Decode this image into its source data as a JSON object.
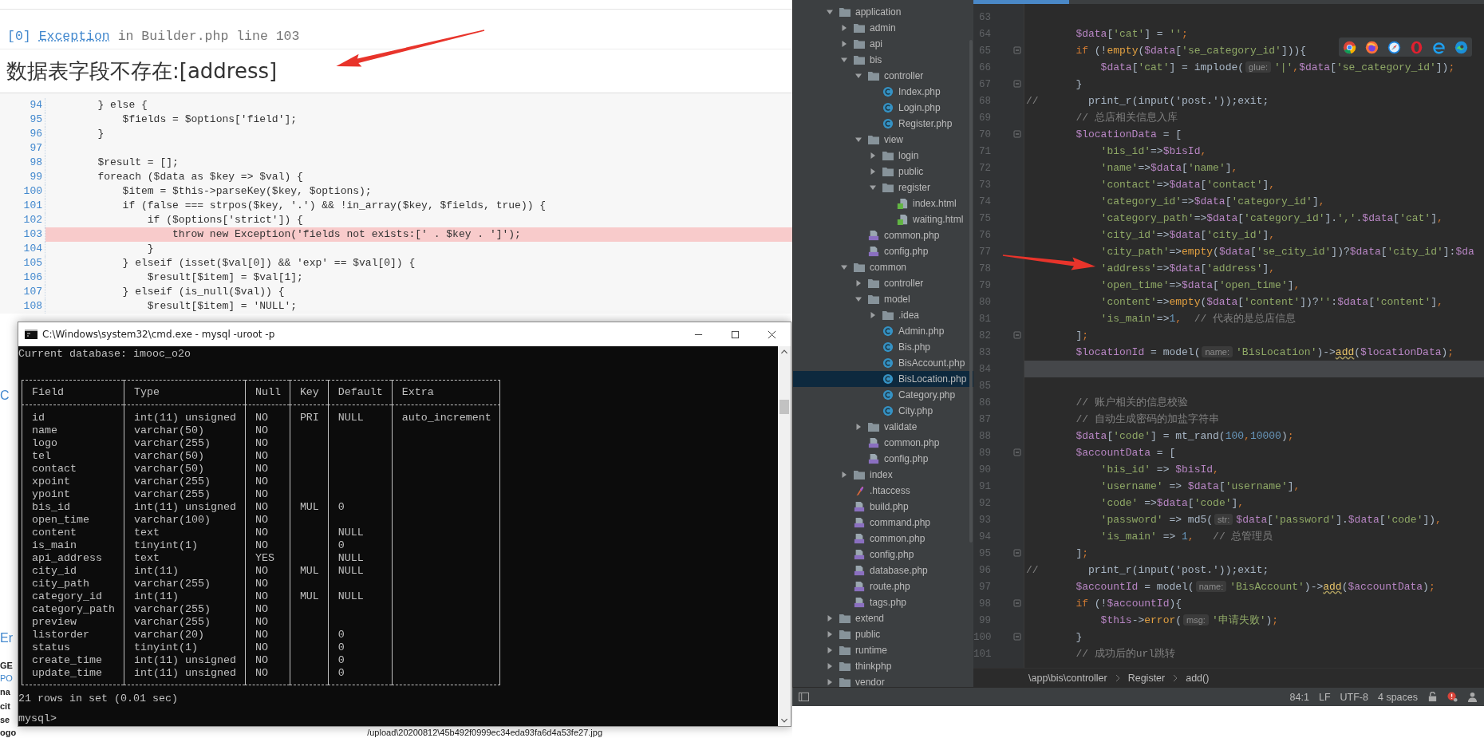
{
  "browser_page": {
    "exception": {
      "index": "[0]",
      "class": "Exception",
      "location": "in Builder.php line 103"
    },
    "message": "数据表字段不存在:[address]",
    "code": [
      {
        "number": "94",
        "text": "        } else {",
        "highlighted": false
      },
      {
        "number": "95",
        "text": "            $fields = $options['field'];",
        "highlighted": false
      },
      {
        "number": "96",
        "text": "        }",
        "highlighted": false
      },
      {
        "number": "97",
        "highlighted": false
      },
      {
        "number": "98",
        "text": "        $result = [];",
        "highlighted": false
      },
      {
        "number": "99",
        "text": "        foreach ($data as $key => $val) {",
        "highlighted": false
      },
      {
        "number": "100",
        "text": "            $item = $this->parseKey($key, $options);",
        "highlighted": false
      },
      {
        "number": "101",
        "text": "            if (false === strpos($key, '.') && !in_array($key, $fields, true)) {",
        "highlighted": false
      },
      {
        "number": "102",
        "text": "                if ($options['strict']) {",
        "highlighted": false
      },
      {
        "number": "103",
        "text": "                    throw new Exception('fields not exists:[' . $key . ']');",
        "highlighted": true
      },
      {
        "number": "104",
        "text": "                }",
        "highlighted": false
      },
      {
        "number": "105",
        "text": "            } elseif (isset($val[0]) && 'exp' == $val[0]) {",
        "highlighted": false
      },
      {
        "number": "106",
        "text": "                $result[$item] = $val[1];",
        "highlighted": false
      },
      {
        "number": "107",
        "text": "            } elseif (is_null($val)) {",
        "highlighted": false
      },
      {
        "number": "108",
        "text": "                $result[$item] = 'NULL';",
        "highlighted": false
      }
    ],
    "fragments": [
      {
        "text": "C",
        "kind": "heading"
      },
      {
        "text": "Er",
        "kind": "heading"
      },
      {
        "text": "GE",
        "kind": "bold"
      },
      {
        "text": "PO",
        "kind": "link"
      },
      {
        "text": "na",
        "kind": "bold"
      },
      {
        "text": "cit",
        "kind": "bold"
      },
      {
        "text": "se",
        "kind": "bold"
      }
    ],
    "footer": {
      "text": "ogo",
      "path": "/upload\\20200812\\45b492f0999ec34eda93fa6d4a53fe27.jpg"
    }
  },
  "console_window": {
    "title": "C:\\Windows\\system32\\cmd.exe - mysql  -uroot -p",
    "header_line": "Current database: imooc_o2o",
    "table": {
      "columns": [
        "Field",
        "Type",
        "Null",
        "Key",
        "Default",
        "Extra"
      ],
      "rows": [
        [
          "id",
          "int(11) unsigned",
          "NO",
          "PRI",
          "NULL",
          "auto_increment"
        ],
        [
          "name",
          "varchar(50)",
          "NO",
          null,
          null,
          null
        ],
        [
          "logo",
          "varchar(255)",
          "NO",
          null,
          null,
          null
        ],
        [
          "tel",
          "varchar(50)",
          "NO",
          null,
          null,
          null
        ],
        [
          "contact",
          "varchar(50)",
          "NO",
          null,
          null,
          null
        ],
        [
          "xpoint",
          "varchar(255)",
          "NO",
          null,
          null,
          null
        ],
        [
          "ypoint",
          "varchar(255)",
          "NO",
          null,
          null,
          null
        ],
        [
          "bis_id",
          "int(11) unsigned",
          "NO",
          "MUL",
          "0",
          null
        ],
        [
          "open_time",
          "varchar(100)",
          "NO",
          null,
          null,
          null
        ],
        [
          "content",
          "text",
          "NO",
          null,
          "NULL",
          null
        ],
        [
          "is_main",
          "tinyint(1)",
          "NO",
          null,
          "0",
          null
        ],
        [
          "api_address",
          "text",
          "YES",
          null,
          "NULL",
          null
        ],
        [
          "city_id",
          "int(11)",
          "NO",
          "MUL",
          "NULL",
          null
        ],
        [
          "city_path",
          "varchar(255)",
          "NO",
          null,
          null,
          null
        ],
        [
          "category_id",
          "int(11)",
          "NO",
          "MUL",
          "NULL",
          null
        ],
        [
          "category_path",
          "varchar(255)",
          "NO",
          null,
          null,
          null
        ],
        [
          "preview",
          "varchar(255)",
          "NO",
          null,
          null,
          null
        ],
        [
          "listorder",
          "varchar(20)",
          "NO",
          null,
          "0",
          null
        ],
        [
          "status",
          "tinyint(1)",
          "NO",
          null,
          "0",
          null
        ],
        [
          "create_time",
          "int(11) unsigned",
          "NO",
          null,
          "0",
          null
        ],
        [
          "update_time",
          "int(11) unsigned",
          "NO",
          null,
          "0",
          null
        ]
      ]
    },
    "summary": "21 rows in set (0.01 sec)",
    "prompt": "mysql>"
  },
  "ide": {
    "tree": [
      {
        "name": "application",
        "kind": "folder",
        "expanded": true,
        "selected": false,
        "children": [
          {
            "name": "admin",
            "kind": "folder",
            "expanded": false,
            "selected": false
          },
          {
            "name": "api",
            "kind": "folder",
            "expanded": false,
            "selected": false
          },
          {
            "name": "bis",
            "kind": "folder",
            "expanded": true,
            "selected": false,
            "children": [
              {
                "name": "controller",
                "kind": "folder",
                "expanded": true,
                "selected": false,
                "children": [
                  {
                    "name": "Index.php",
                    "kind": "class",
                    "selected": false
                  },
                  {
                    "name": "Login.php",
                    "kind": "class",
                    "selected": false
                  },
                  {
                    "name": "Register.php",
                    "kind": "class",
                    "selected": false
                  }
                ]
              },
              {
                "name": "view",
                "kind": "folder",
                "expanded": true,
                "selected": false,
                "children": [
                  {
                    "name": "login",
                    "kind": "folder",
                    "expanded": false,
                    "selected": false
                  },
                  {
                    "name": "public",
                    "kind": "folder",
                    "expanded": false,
                    "selected": false
                  },
                  {
                    "name": "register",
                    "kind": "folder",
                    "expanded": true,
                    "selected": false,
                    "children": [
                      {
                        "name": "index.html",
                        "kind": "html",
                        "selected": false
                      },
                      {
                        "name": "waiting.html",
                        "kind": "html",
                        "selected": false
                      }
                    ]
                  }
                ]
              },
              {
                "name": "common.php",
                "kind": "php",
                "selected": false
              },
              {
                "name": "config.php",
                "kind": "php",
                "selected": false
              }
            ]
          },
          {
            "name": "common",
            "kind": "folder",
            "expanded": true,
            "selected": false,
            "children": [
              {
                "name": "controller",
                "kind": "folder",
                "expanded": false,
                "selected": false
              },
              {
                "name": "model",
                "kind": "folder",
                "expanded": true,
                "selected": false,
                "children": [
                  {
                    "name": ".idea",
                    "kind": "folder",
                    "expanded": false,
                    "selected": false
                  },
                  {
                    "name": "Admin.php",
                    "kind": "class",
                    "selected": false
                  },
                  {
                    "name": "Bis.php",
                    "kind": "class",
                    "selected": false
                  },
                  {
                    "name": "BisAccount.php",
                    "kind": "class",
                    "selected": false
                  },
                  {
                    "name": "BisLocation.php",
                    "kind": "class",
                    "selected": true
                  },
                  {
                    "name": "Category.php",
                    "kind": "class",
                    "selected": false
                  },
                  {
                    "name": "City.php",
                    "kind": "class",
                    "selected": false
                  }
                ]
              },
              {
                "name": "validate",
                "kind": "folder",
                "expanded": false,
                "selected": false
              },
              {
                "name": "common.php",
                "kind": "php",
                "selected": false
              },
              {
                "name": "config.php",
                "kind": "php",
                "selected": false
              }
            ]
          },
          {
            "name": "index",
            "kind": "folder",
            "expanded": false,
            "selected": false
          },
          {
            "name": ".htaccess",
            "kind": "htaccess",
            "selected": false
          },
          {
            "name": "build.php",
            "kind": "php",
            "selected": false
          },
          {
            "name": "command.php",
            "kind": "php",
            "selected": false
          },
          {
            "name": "common.php",
            "kind": "php",
            "selected": false
          },
          {
            "name": "config.php",
            "kind": "php",
            "selected": false
          },
          {
            "name": "database.php",
            "kind": "php",
            "selected": false
          },
          {
            "name": "route.php",
            "kind": "php",
            "selected": false
          },
          {
            "name": "tags.php",
            "kind": "php",
            "selected": false
          }
        ]
      },
      {
        "name": "extend",
        "kind": "folder",
        "expanded": false,
        "selected": false
      },
      {
        "name": "public",
        "kind": "folder",
        "expanded": false,
        "selected": false
      },
      {
        "name": "runtime",
        "kind": "folder",
        "expanded": false,
        "selected": false
      },
      {
        "name": "thinkphp",
        "kind": "folder",
        "expanded": false,
        "selected": false
      },
      {
        "name": "vendor",
        "kind": "folder",
        "expanded": false,
        "selected": false
      }
    ],
    "editor": {
      "lines": [
        {
          "number": "63",
          "fold": false,
          "current": false
        },
        {
          "number": "64",
          "fold": false,
          "current": false,
          "tokens": [
            {
              "kind": "var",
              "text": "        $data"
            },
            {
              "kind": "plain",
              "text": "["
            },
            {
              "kind": "str",
              "text": "'cat'"
            },
            {
              "kind": "plain",
              "text": "] = "
            },
            {
              "kind": "str",
              "text": "''"
            },
            {
              "kind": "kw",
              "text": ";"
            }
          ]
        },
        {
          "number": "65",
          "fold": true,
          "current": false,
          "tokens": [
            {
              "kind": "kw",
              "text": "        if"
            },
            {
              "kind": "plain",
              "text": " (!"
            },
            {
              "kind": "fn",
              "text": "empty"
            },
            {
              "kind": "plain",
              "text": "("
            },
            {
              "kind": "var",
              "text": "$data"
            },
            {
              "kind": "plain",
              "text": "["
            },
            {
              "kind": "str",
              "text": "'se_category_id'"
            },
            {
              "kind": "plain",
              "text": "])){"
            }
          ]
        },
        {
          "number": "66",
          "fold": false,
          "current": false,
          "tokens": [
            {
              "kind": "var",
              "text": "            $data"
            },
            {
              "kind": "plain",
              "text": "["
            },
            {
              "kind": "str",
              "text": "'cat'"
            },
            {
              "kind": "plain",
              "text": "] = implode("
            },
            {
              "kind": "hint",
              "text": "glue:"
            },
            {
              "kind": "str",
              "text": "'|'"
            },
            {
              "kind": "kw",
              "text": ","
            },
            {
              "kind": "var",
              "text": "$data"
            },
            {
              "kind": "plain",
              "text": "["
            },
            {
              "kind": "str",
              "text": "'se_category_id'"
            },
            {
              "kind": "plain",
              "text": "])"
            },
            {
              "kind": "kw",
              "text": ";"
            }
          ]
        },
        {
          "number": "67",
          "fold": true,
          "current": false,
          "tokens": [
            {
              "kind": "plain",
              "text": "        }"
            }
          ]
        },
        {
          "number": "68",
          "fold": false,
          "current": false,
          "tokens": [
            {
              "kind": "comment",
              "text": "//"
            },
            {
              "kind": "plain",
              "text": "        print_r(input('post.'));exit;"
            }
          ]
        },
        {
          "number": "69",
          "fold": false,
          "current": false,
          "tokens": [
            {
              "kind": "comment",
              "text": "        // 总店相关信息入库"
            }
          ]
        },
        {
          "number": "70",
          "fold": true,
          "current": false,
          "tokens": [
            {
              "kind": "var",
              "text": "        $locationData"
            },
            {
              "kind": "plain",
              "text": " = ["
            }
          ]
        },
        {
          "number": "71",
          "fold": false,
          "current": false,
          "tokens": [
            {
              "kind": "str",
              "text": "            'bis_id'"
            },
            {
              "kind": "plain",
              "text": "=>"
            },
            {
              "kind": "var",
              "text": "$bisId"
            },
            {
              "kind": "kw",
              "text": ","
            }
          ]
        },
        {
          "number": "72",
          "fold": false,
          "current": false,
          "tokens": [
            {
              "kind": "str",
              "text": "            'name'"
            },
            {
              "kind": "plain",
              "text": "=>"
            },
            {
              "kind": "var",
              "text": "$data"
            },
            {
              "kind": "plain",
              "text": "["
            },
            {
              "kind": "str",
              "text": "'name'"
            },
            {
              "kind": "plain",
              "text": "]"
            },
            {
              "kind": "kw",
              "text": ","
            }
          ]
        },
        {
          "number": "73",
          "fold": false,
          "current": false,
          "tokens": [
            {
              "kind": "str",
              "text": "            'contact'"
            },
            {
              "kind": "plain",
              "text": "=>"
            },
            {
              "kind": "var",
              "text": "$data"
            },
            {
              "kind": "plain",
              "text": "["
            },
            {
              "kind": "str",
              "text": "'contact'"
            },
            {
              "kind": "plain",
              "text": "]"
            },
            {
              "kind": "kw",
              "text": ","
            }
          ]
        },
        {
          "number": "74",
          "fold": false,
          "current": false,
          "tokens": [
            {
              "kind": "str",
              "text": "            'category_id'"
            },
            {
              "kind": "plain",
              "text": "=>"
            },
            {
              "kind": "var",
              "text": "$data"
            },
            {
              "kind": "plain",
              "text": "["
            },
            {
              "kind": "str",
              "text": "'category_id'"
            },
            {
              "kind": "plain",
              "text": "]"
            },
            {
              "kind": "kw",
              "text": ","
            }
          ]
        },
        {
          "number": "75",
          "fold": false,
          "current": false,
          "tokens": [
            {
              "kind": "str",
              "text": "            'category_path'"
            },
            {
              "kind": "plain",
              "text": "=>"
            },
            {
              "kind": "var",
              "text": "$data"
            },
            {
              "kind": "plain",
              "text": "["
            },
            {
              "kind": "str",
              "text": "'category_id'"
            },
            {
              "kind": "plain",
              "text": "]."
            },
            {
              "kind": "str",
              "text": "','"
            },
            {
              "kind": "plain",
              "text": "."
            },
            {
              "kind": "var",
              "text": "$data"
            },
            {
              "kind": "plain",
              "text": "["
            },
            {
              "kind": "str",
              "text": "'cat'"
            },
            {
              "kind": "plain",
              "text": "]"
            },
            {
              "kind": "kw",
              "text": ","
            }
          ]
        },
        {
          "number": "76",
          "fold": false,
          "current": false,
          "tokens": [
            {
              "kind": "str",
              "text": "            'city_id'"
            },
            {
              "kind": "plain",
              "text": "=>"
            },
            {
              "kind": "var",
              "text": "$data"
            },
            {
              "kind": "plain",
              "text": "["
            },
            {
              "kind": "str",
              "text": "'city_id'"
            },
            {
              "kind": "plain",
              "text": "]"
            },
            {
              "kind": "kw",
              "text": ","
            }
          ]
        },
        {
          "number": "77",
          "fold": false,
          "current": false,
          "tokens": [
            {
              "kind": "str",
              "text": "            'city_path'"
            },
            {
              "kind": "plain",
              "text": "=>"
            },
            {
              "kind": "fn",
              "text": "empty"
            },
            {
              "kind": "plain",
              "text": "("
            },
            {
              "kind": "var",
              "text": "$data"
            },
            {
              "kind": "plain",
              "text": "["
            },
            {
              "kind": "str",
              "text": "'se_city_id'"
            },
            {
              "kind": "plain",
              "text": "])?"
            },
            {
              "kind": "var",
              "text": "$data"
            },
            {
              "kind": "plain",
              "text": "["
            },
            {
              "kind": "str",
              "text": "'city_id'"
            },
            {
              "kind": "plain",
              "text": "]:"
            },
            {
              "kind": "var",
              "text": "$da"
            }
          ]
        },
        {
          "number": "78",
          "fold": false,
          "current": false,
          "tokens": [
            {
              "kind": "str",
              "text": "            'address'"
            },
            {
              "kind": "plain",
              "text": "=>"
            },
            {
              "kind": "var",
              "text": "$data"
            },
            {
              "kind": "plain",
              "text": "["
            },
            {
              "kind": "str",
              "text": "'address'"
            },
            {
              "kind": "plain",
              "text": "]"
            },
            {
              "kind": "kw",
              "text": ","
            }
          ]
        },
        {
          "number": "79",
          "fold": false,
          "current": false,
          "tokens": [
            {
              "kind": "str",
              "text": "            'open_time'"
            },
            {
              "kind": "plain",
              "text": "=>"
            },
            {
              "kind": "var",
              "text": "$data"
            },
            {
              "kind": "plain",
              "text": "["
            },
            {
              "kind": "str",
              "text": "'open_time'"
            },
            {
              "kind": "plain",
              "text": "]"
            },
            {
              "kind": "kw",
              "text": ","
            }
          ]
        },
        {
          "number": "80",
          "fold": false,
          "current": false,
          "tokens": [
            {
              "kind": "str",
              "text": "            'content'"
            },
            {
              "kind": "plain",
              "text": "=>"
            },
            {
              "kind": "fn",
              "text": "empty"
            },
            {
              "kind": "plain",
              "text": "("
            },
            {
              "kind": "var",
              "text": "$data"
            },
            {
              "kind": "plain",
              "text": "["
            },
            {
              "kind": "str",
              "text": "'content'"
            },
            {
              "kind": "plain",
              "text": "])?"
            },
            {
              "kind": "str",
              "text": "''"
            },
            {
              "kind": "plain",
              "text": ":"
            },
            {
              "kind": "var",
              "text": "$data"
            },
            {
              "kind": "plain",
              "text": "["
            },
            {
              "kind": "str",
              "text": "'content'"
            },
            {
              "kind": "plain",
              "text": "]"
            },
            {
              "kind": "kw",
              "text": ","
            }
          ]
        },
        {
          "number": "81",
          "fold": false,
          "current": false,
          "tokens": [
            {
              "kind": "str",
              "text": "            'is_main'"
            },
            {
              "kind": "plain",
              "text": "=>"
            },
            {
              "kind": "num",
              "text": "1"
            },
            {
              "kind": "kw",
              "text": ","
            },
            {
              "kind": "comment",
              "text": "  // 代表的是总店信息"
            }
          ]
        },
        {
          "number": "82",
          "fold": true,
          "current": false,
          "tokens": [
            {
              "kind": "plain",
              "text": "        ]"
            },
            {
              "kind": "kw",
              "text": ";"
            }
          ]
        },
        {
          "number": "83",
          "fold": false,
          "current": false,
          "tokens": [
            {
              "kind": "var",
              "text": "        $locationId"
            },
            {
              "kind": "plain",
              "text": " = model("
            },
            {
              "kind": "hint",
              "text": "name:"
            },
            {
              "kind": "str",
              "text": "'BisLocation'"
            },
            {
              "kind": "plain",
              "text": ")->"
            },
            {
              "kind": "call",
              "text": "add"
            },
            {
              "kind": "plain",
              "text": "("
            },
            {
              "kind": "var",
              "text": "$locationData"
            },
            {
              "kind": "plain",
              "text": ")"
            },
            {
              "kind": "kw",
              "text": ";"
            }
          ]
        },
        {
          "number": "84",
          "fold": false,
          "current": true
        },
        {
          "number": "85",
          "fold": false,
          "current": false
        },
        {
          "number": "86",
          "fold": false,
          "current": false,
          "tokens": [
            {
              "kind": "comment",
              "text": "        // 账户相关的信息校验"
            }
          ]
        },
        {
          "number": "87",
          "fold": false,
          "current": false,
          "tokens": [
            {
              "kind": "comment",
              "text": "        // 自动生成密码的加盐字符串"
            }
          ]
        },
        {
          "number": "88",
          "fold": false,
          "current": false,
          "tokens": [
            {
              "kind": "var",
              "text": "        $data"
            },
            {
              "kind": "plain",
              "text": "["
            },
            {
              "kind": "str",
              "text": "'code'"
            },
            {
              "kind": "plain",
              "text": "] = mt_rand("
            },
            {
              "kind": "num",
              "text": "100"
            },
            {
              "kind": "kw",
              "text": ","
            },
            {
              "kind": "num",
              "text": "10000"
            },
            {
              "kind": "plain",
              "text": ")"
            },
            {
              "kind": "kw",
              "text": ";"
            }
          ]
        },
        {
          "number": "89",
          "fold": true,
          "current": false,
          "tokens": [
            {
              "kind": "var",
              "text": "        $accountData"
            },
            {
              "kind": "plain",
              "text": " = ["
            }
          ]
        },
        {
          "number": "90",
          "fold": false,
          "current": false,
          "tokens": [
            {
              "kind": "str",
              "text": "            'bis_id'"
            },
            {
              "kind": "plain",
              "text": " => "
            },
            {
              "kind": "var",
              "text": "$bisId"
            },
            {
              "kind": "kw",
              "text": ","
            }
          ]
        },
        {
          "number": "91",
          "fold": false,
          "current": false,
          "tokens": [
            {
              "kind": "str",
              "text": "            'username'"
            },
            {
              "kind": "plain",
              "text": " => "
            },
            {
              "kind": "var",
              "text": "$data"
            },
            {
              "kind": "plain",
              "text": "["
            },
            {
              "kind": "str",
              "text": "'username'"
            },
            {
              "kind": "plain",
              "text": "]"
            },
            {
              "kind": "kw",
              "text": ","
            }
          ]
        },
        {
          "number": "92",
          "fold": false,
          "current": false,
          "tokens": [
            {
              "kind": "str",
              "text": "            'code'"
            },
            {
              "kind": "plain",
              "text": " =>"
            },
            {
              "kind": "var",
              "text": "$data"
            },
            {
              "kind": "plain",
              "text": "["
            },
            {
              "kind": "str",
              "text": "'code'"
            },
            {
              "kind": "plain",
              "text": "]"
            },
            {
              "kind": "kw",
              "text": ","
            }
          ]
        },
        {
          "number": "93",
          "fold": false,
          "current": false,
          "tokens": [
            {
              "kind": "str",
              "text": "            'password'"
            },
            {
              "kind": "plain",
              "text": " => md5("
            },
            {
              "kind": "hint",
              "text": "str:"
            },
            {
              "kind": "var",
              "text": "$data"
            },
            {
              "kind": "plain",
              "text": "["
            },
            {
              "kind": "str",
              "text": "'password'"
            },
            {
              "kind": "plain",
              "text": "]."
            },
            {
              "kind": "var",
              "text": "$data"
            },
            {
              "kind": "plain",
              "text": "["
            },
            {
              "kind": "str",
              "text": "'code'"
            },
            {
              "kind": "plain",
              "text": "])"
            },
            {
              "kind": "kw",
              "text": ","
            }
          ]
        },
        {
          "number": "94",
          "fold": false,
          "current": false,
          "tokens": [
            {
              "kind": "str",
              "text": "            'is_main'"
            },
            {
              "kind": "plain",
              "text": " => "
            },
            {
              "kind": "num",
              "text": "1"
            },
            {
              "kind": "kw",
              "text": ","
            },
            {
              "kind": "comment",
              "text": "   // 总管理员"
            }
          ]
        },
        {
          "number": "95",
          "fold": true,
          "current": false,
          "tokens": [
            {
              "kind": "plain",
              "text": "        ]"
            },
            {
              "kind": "kw",
              "text": ";"
            }
          ]
        },
        {
          "number": "96",
          "fold": false,
          "current": false,
          "tokens": [
            {
              "kind": "comment",
              "text": "//"
            },
            {
              "kind": "plain",
              "text": "        print_r(input('post.'));exit;"
            }
          ]
        },
        {
          "number": "97",
          "fold": false,
          "current": false,
          "tokens": [
            {
              "kind": "var",
              "text": "        $accountId"
            },
            {
              "kind": "plain",
              "text": " = model("
            },
            {
              "kind": "hint",
              "text": "name:"
            },
            {
              "kind": "str",
              "text": "'BisAccount'"
            },
            {
              "kind": "plain",
              "text": ")->"
            },
            {
              "kind": "call",
              "text": "add"
            },
            {
              "kind": "plain",
              "text": "("
            },
            {
              "kind": "var",
              "text": "$accountData"
            },
            {
              "kind": "plain",
              "text": ")"
            },
            {
              "kind": "kw",
              "text": ";"
            }
          ]
        },
        {
          "number": "98",
          "fold": true,
          "current": false,
          "tokens": [
            {
              "kind": "kw",
              "text": "        if"
            },
            {
              "kind": "plain",
              "text": " (!"
            },
            {
              "kind": "var",
              "text": "$accountId"
            },
            {
              "kind": "plain",
              "text": "){"
            }
          ]
        },
        {
          "number": "99",
          "fold": false,
          "current": false,
          "tokens": [
            {
              "kind": "var",
              "text": "            $this"
            },
            {
              "kind": "plain",
              "text": "->"
            },
            {
              "kind": "fn",
              "text": "error"
            },
            {
              "kind": "plain",
              "text": "("
            },
            {
              "kind": "hint",
              "text": "msg:"
            },
            {
              "kind": "str",
              "text": "'申请失败'"
            },
            {
              "kind": "plain",
              "text": ")"
            },
            {
              "kind": "kw",
              "text": ";"
            }
          ]
        },
        {
          "number": "100",
          "fold": true,
          "current": false,
          "tokens": [
            {
              "kind": "plain",
              "text": "        }"
            }
          ]
        },
        {
          "number": "101",
          "fold": false,
          "current": false,
          "tokens": [
            {
              "kind": "comment",
              "text": "        // 成功后的url跳转"
            }
          ]
        }
      ]
    },
    "breadcrumb": [
      "\\app\\bis\\controller",
      "Register",
      "add()"
    ],
    "status_bar": {
      "position": "84:1",
      "line_ending": "LF",
      "encoding": "UTF-8",
      "indent": "4 spaces"
    }
  }
}
